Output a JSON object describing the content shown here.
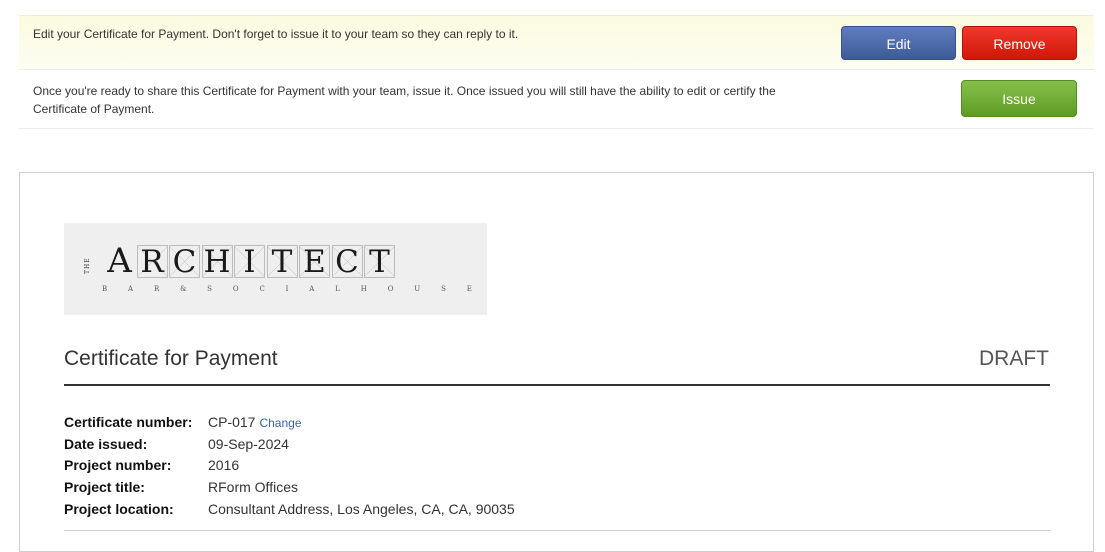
{
  "notices": {
    "edit_message": "Edit your Certificate for Payment. Don't forget to issue it to your team so they can reply to it.",
    "issue_message": "Once you're ready to share this Certificate for Payment with your team, issue it. Once issued you will still have the ability to edit or certify the Certificate of Payment."
  },
  "buttons": {
    "edit": "Edit",
    "remove": "Remove",
    "issue": "Issue"
  },
  "logo": {
    "the": "THE",
    "letters": [
      "A",
      "R",
      "C",
      "H",
      "I",
      "T",
      "E",
      "C",
      "T"
    ],
    "tagline": [
      "B",
      "A",
      "R",
      "&",
      "S",
      "O",
      "C",
      "I",
      "A",
      "L",
      "H",
      "O",
      "U",
      "S",
      "E"
    ]
  },
  "document": {
    "title": "Certificate for Payment",
    "status": "DRAFT",
    "change_link": "Change",
    "fields": [
      {
        "label": "Certificate number:",
        "value": "CP-017"
      },
      {
        "label": "Date issued:",
        "value": "09-Sep-2024"
      },
      {
        "label": "Project number:",
        "value": "2016"
      },
      {
        "label": "Project title:",
        "value": "RForm Offices"
      },
      {
        "label": "Project location:",
        "value": "Consultant Address, Los Angeles, CA, CA, 90035"
      }
    ]
  },
  "colors": {
    "edit_button": "#3d5a99",
    "remove_button": "#cf1709",
    "issue_button": "#5e9b25",
    "link": "#3b63a8"
  }
}
